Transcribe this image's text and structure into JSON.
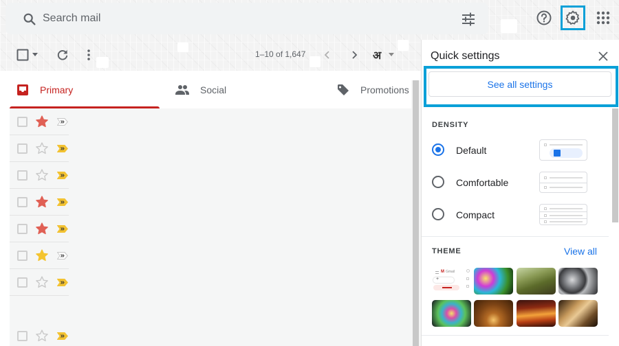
{
  "search": {
    "placeholder": "Search mail",
    "icon": "search-icon",
    "options_icon": "tune-icon"
  },
  "header": {
    "help_icon": "help-icon",
    "settings_icon": "gear-icon",
    "apps_icon": "apps-grid-icon",
    "highlight_color": "#0aa0d8"
  },
  "toolbar": {
    "select_icon": "checkbox-icon",
    "select_menu_icon": "caret-down-icon",
    "refresh_icon": "refresh-icon",
    "more_icon": "more-vert-icon",
    "page_info": "1–10 of 1,647",
    "prev_icon": "chevron-left-icon",
    "next_icon": "chevron-right-icon",
    "input_tools_label": "अ",
    "input_tools_menu_icon": "caret-down-icon"
  },
  "tabs": [
    {
      "label": "Primary",
      "icon": "inbox-icon",
      "active": true,
      "color": "#c5221f"
    },
    {
      "label": "Social",
      "icon": "people-icon",
      "active": false
    },
    {
      "label": "Promotions",
      "icon": "tag-icon",
      "active": false
    }
  ],
  "mail_rows": [
    {
      "checked": false,
      "starred": true,
      "star_color": "#e06055",
      "important": false
    },
    {
      "checked": false,
      "starred": false,
      "important": true
    },
    {
      "checked": false,
      "starred": false,
      "important": true
    },
    {
      "checked": false,
      "starred": true,
      "star_color": "#e06055",
      "important": true
    },
    {
      "checked": false,
      "starred": true,
      "star_color": "#e06055",
      "important": true
    },
    {
      "checked": false,
      "starred": true,
      "star_color": "#f4c430",
      "important": false
    },
    {
      "checked": false,
      "starred": false,
      "important": true
    },
    {
      "checked": false,
      "starred": false,
      "important": true
    }
  ],
  "quick_settings": {
    "title": "Quick settings",
    "close_icon": "close-icon",
    "see_all_label": "See all settings",
    "density": {
      "heading": "DENSITY",
      "options": [
        {
          "label": "Default",
          "selected": true
        },
        {
          "label": "Comfortable",
          "selected": false
        },
        {
          "label": "Compact",
          "selected": false
        }
      ]
    },
    "theme": {
      "heading": "THEME",
      "view_all_label": "View all",
      "thumbnails": [
        "default-theme",
        "rainbow-bokeh-theme",
        "forest-theme",
        "grey-spheres-theme",
        "colorful-lights-theme",
        "wooden-tunnel-theme",
        "canyon-theme",
        "chess-theme"
      ],
      "default_thumb_label": "Gmail"
    }
  }
}
